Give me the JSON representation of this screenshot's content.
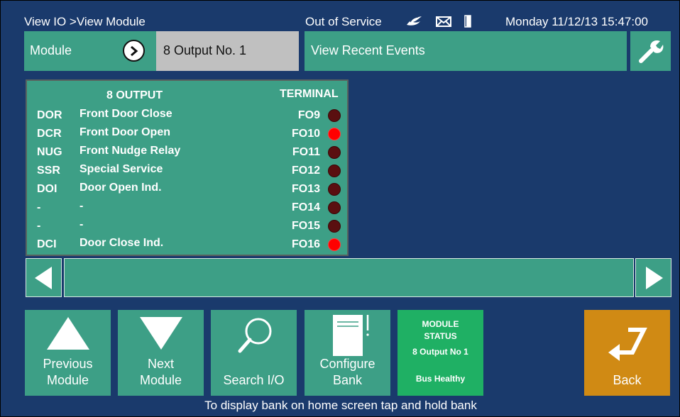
{
  "header": {
    "breadcrumb": "View IO >View Module",
    "status": "Out of Service",
    "datetime": "Monday 11/12/13 15:47:00"
  },
  "module": {
    "label": "Module",
    "name": "8 Output No. 1"
  },
  "events": {
    "label": "View Recent Events"
  },
  "bank": {
    "title": "8 OUTPUT",
    "terminal_header": "TERMINAL",
    "rows": [
      {
        "code": "DOR",
        "description": "Front Door Close",
        "terminal": "FO9",
        "on": false
      },
      {
        "code": "DCR",
        "description": "Front Door Open",
        "terminal": "FO10",
        "on": true
      },
      {
        "code": "NUG",
        "description": "Front Nudge Relay",
        "terminal": "FO11",
        "on": false
      },
      {
        "code": "SSR",
        "description": "Special Service",
        "terminal": "FO12",
        "on": false
      },
      {
        "code": "DOI",
        "description": "Door Open Ind.",
        "terminal": "FO13",
        "on": false
      },
      {
        "code": "-",
        "description": "-",
        "terminal": "FO14",
        "on": false
      },
      {
        "code": "-",
        "description": "-",
        "terminal": "FO15",
        "on": false
      },
      {
        "code": "DCI",
        "description": "Door Close Ind.",
        "terminal": "FO16",
        "on": true
      }
    ],
    "led_on_color": "#ff0000",
    "led_off_color": "#5a0f10"
  },
  "buttons": {
    "previous_line1": "Previous",
    "previous_line2": "Module",
    "next_line1": "Next",
    "next_line2": "Module",
    "search": "Search I/O",
    "configure_line1": "Configure",
    "configure_line2": "Bank",
    "back": "Back"
  },
  "module_status": {
    "title_line1": "MODULE",
    "title_line2": "STATUS",
    "module": "8 Output No 1",
    "health": "Bus Healthy"
  },
  "footer": {
    "hint": "To display bank on home screen tap and hold bank"
  },
  "colors": {
    "background": "#1a3a6c",
    "panel": "#3d9f86",
    "status_ok": "#1fb064",
    "back": "#d08a14"
  },
  "icons": {
    "status_icons": [
      "doves-icon",
      "mail-icon",
      "door-icon"
    ]
  }
}
